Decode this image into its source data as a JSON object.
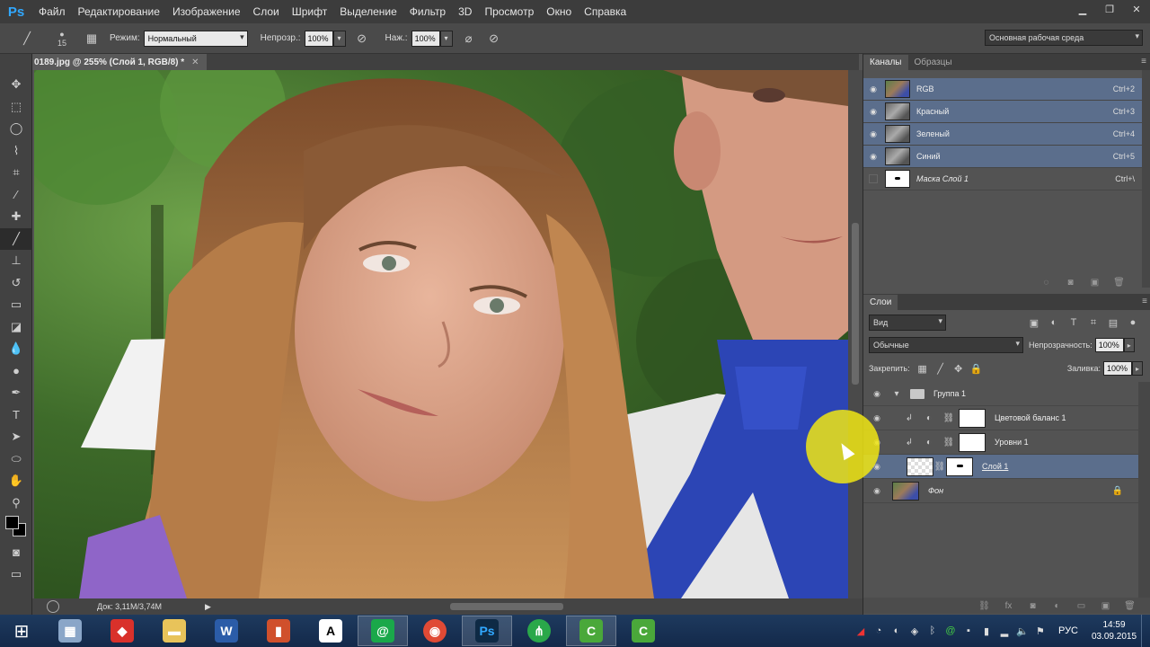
{
  "menubar": {
    "logo": "Ps",
    "items": [
      "Файл",
      "Редактирование",
      "Изображение",
      "Слои",
      "Шрифт",
      "Выделение",
      "Фильтр",
      "3D",
      "Просмотр",
      "Окно",
      "Справка"
    ]
  },
  "options": {
    "brush_size": "15",
    "mode_label": "Режим:",
    "mode_value": "Нормальный",
    "opacity_label": "Непрозр.:",
    "opacity_value": "100%",
    "pressure_label": "Наж.:",
    "pressure_value": "100%",
    "workspace": "Основная рабочая среда"
  },
  "document": {
    "tab_title": "0189.jpg @ 255% (Слой 1, RGB/8) *",
    "doc_size": "Док: 3,11M/3,74M"
  },
  "channels_panel": {
    "tabs": [
      "Каналы",
      "Образцы"
    ],
    "channels": [
      {
        "name": "RGB",
        "shortcut": "Ctrl+2"
      },
      {
        "name": "Красный",
        "shortcut": "Ctrl+3"
      },
      {
        "name": "Зеленый",
        "shortcut": "Ctrl+4"
      },
      {
        "name": "Синий",
        "shortcut": "Ctrl+5"
      },
      {
        "name": "Маска Слой 1",
        "shortcut": "Ctrl+\\"
      }
    ]
  },
  "layers_panel": {
    "tab": "Слои",
    "filter_kind": "Вид",
    "blend_mode": "Обычные",
    "opacity_label": "Непрозрачность:",
    "opacity_value": "100%",
    "lock_label": "Закрепить:",
    "fill_label": "Заливка:",
    "fill_value": "100%",
    "layers": [
      {
        "name": "Группа 1"
      },
      {
        "name": "Цветовой баланс 1"
      },
      {
        "name": "Уровни 1"
      },
      {
        "name": "Слой 1"
      },
      {
        "name": "Фон"
      }
    ]
  },
  "taskbar": {
    "language": "РУС",
    "time": "14:59",
    "date": "03.09.2015"
  }
}
